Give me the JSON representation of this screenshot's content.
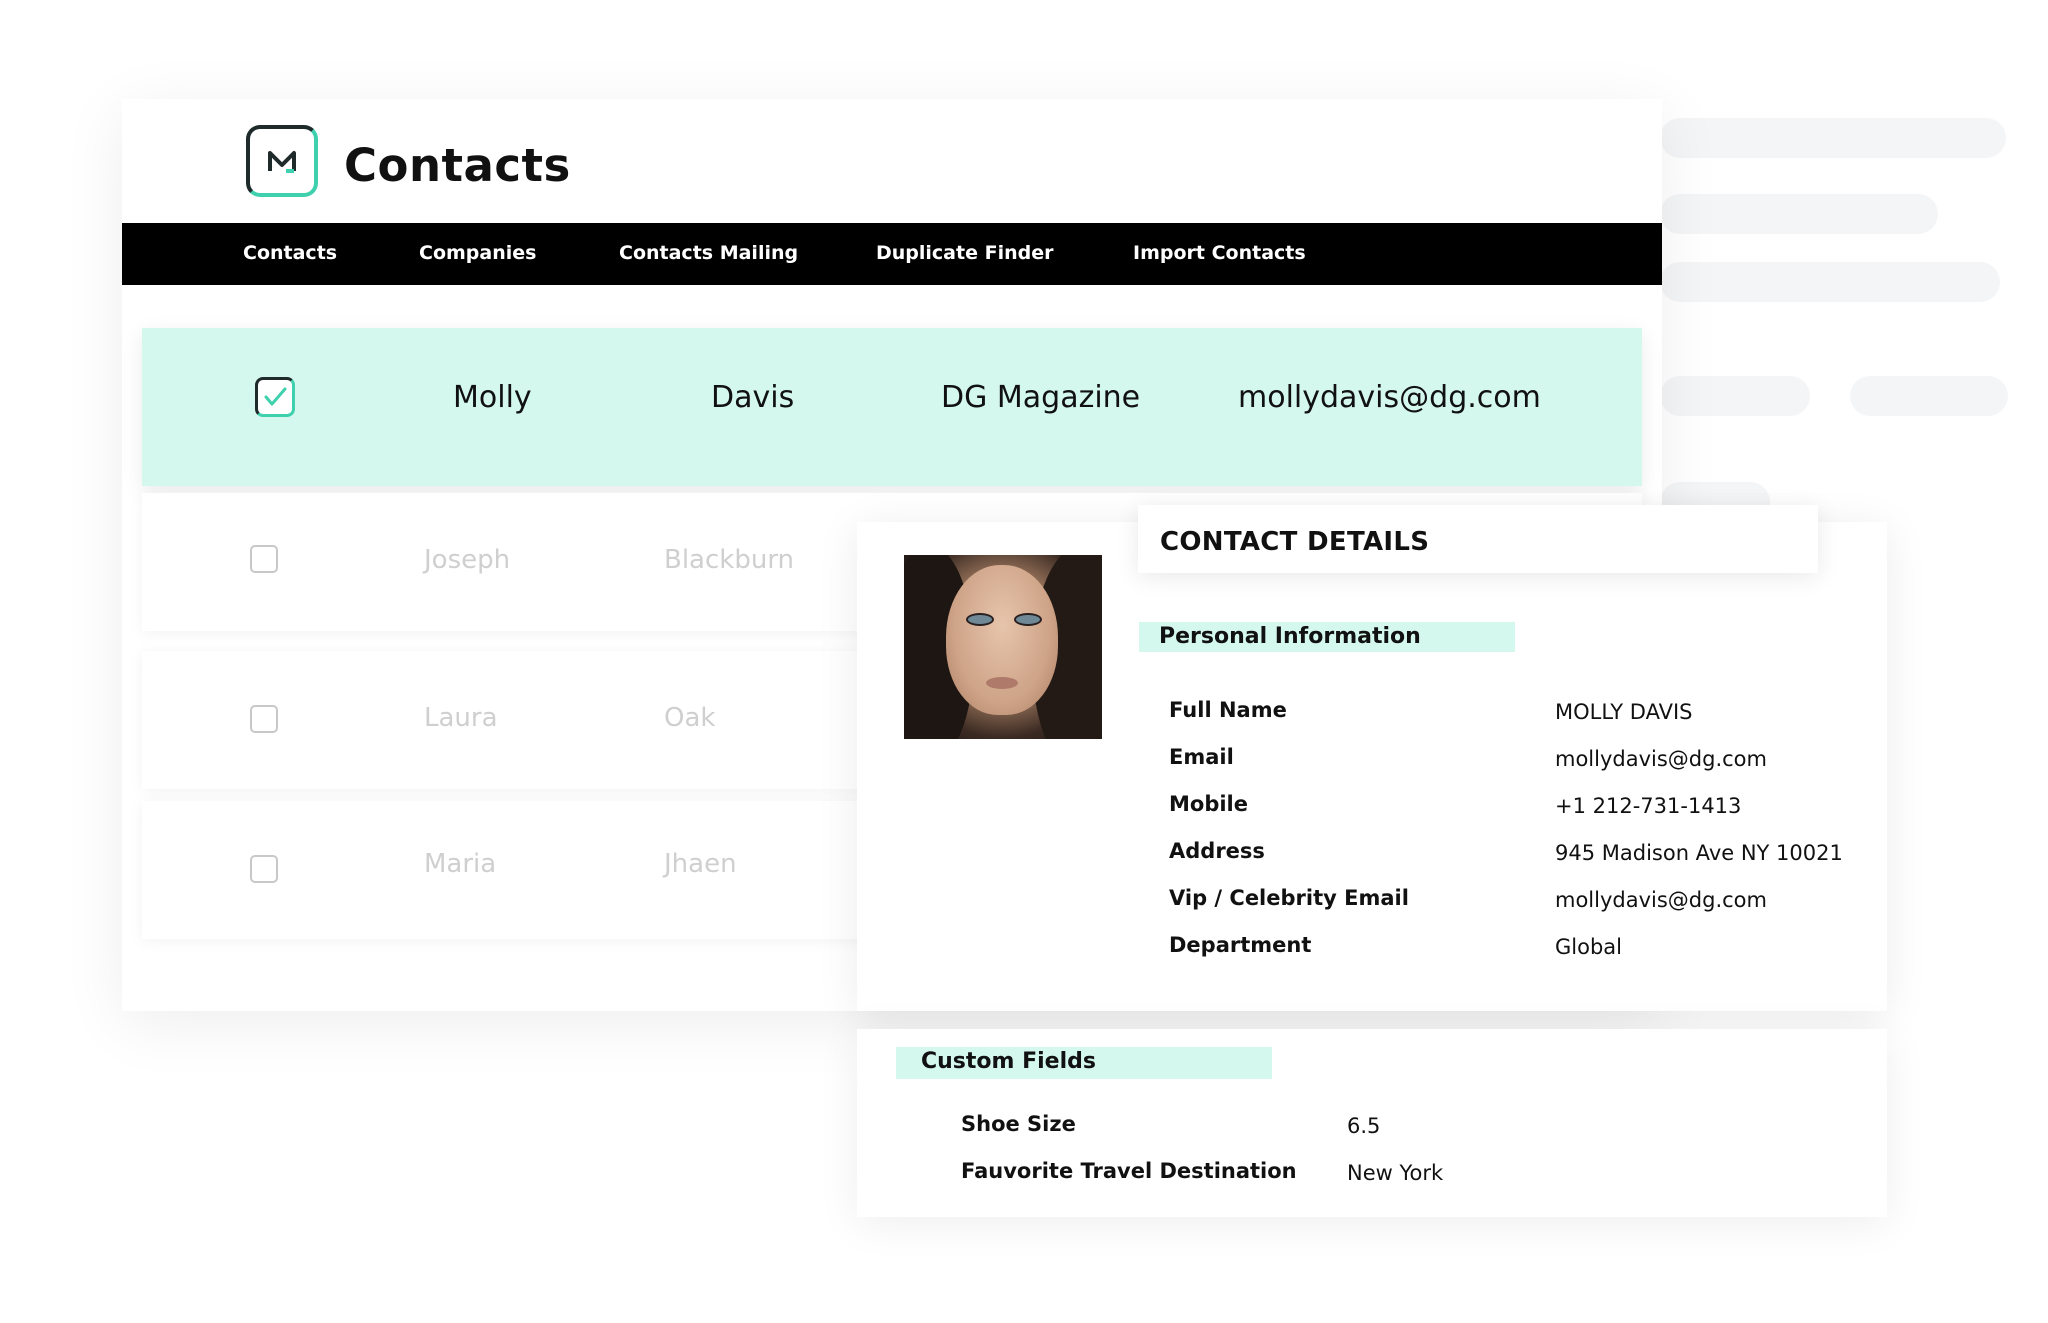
{
  "app": {
    "title": "Contacts",
    "logo_icon": "m-logo-icon",
    "brand_color": "#3fd0ad",
    "highlight_color": "#d4f8ee"
  },
  "nav": {
    "items": [
      {
        "label": "Contacts"
      },
      {
        "label": "Companies"
      },
      {
        "label": "Contacts Mailing"
      },
      {
        "label": "Duplicate Finder"
      },
      {
        "label": "Import Contacts"
      }
    ]
  },
  "contacts": {
    "rows": [
      {
        "first": "Molly",
        "last": "Davis",
        "company": "DG Magazine",
        "email": "mollydavis@dg.com",
        "checked": true
      },
      {
        "first": "Joseph",
        "last": "Blackburn",
        "checked": false
      },
      {
        "first": "Laura",
        "last": "Oak",
        "checked": false
      },
      {
        "first": "Maria",
        "last": "Jhaen",
        "checked": false
      }
    ]
  },
  "details": {
    "title": "CONTACT DETAILS",
    "personal_section": "Personal Information",
    "fields": [
      {
        "label": "Full Name",
        "value": "MOLLY DAVIS"
      },
      {
        "label": "Email",
        "value": "mollydavis@dg.com"
      },
      {
        "label": "Mobile",
        "value": "+1 212-731-1413"
      },
      {
        "label": "Address",
        "value": "945 Madison Ave NY 10021"
      },
      {
        "label": "Vip / Celebrity Email",
        "value": "mollydavis@dg.com"
      },
      {
        "label": "Department",
        "value": "Global"
      }
    ],
    "custom_section": "Custom Fields",
    "custom_fields": [
      {
        "label": "Shoe Size",
        "value": "6.5"
      },
      {
        "label": "Fauvorite Travel Destination",
        "value": "New York"
      }
    ]
  }
}
